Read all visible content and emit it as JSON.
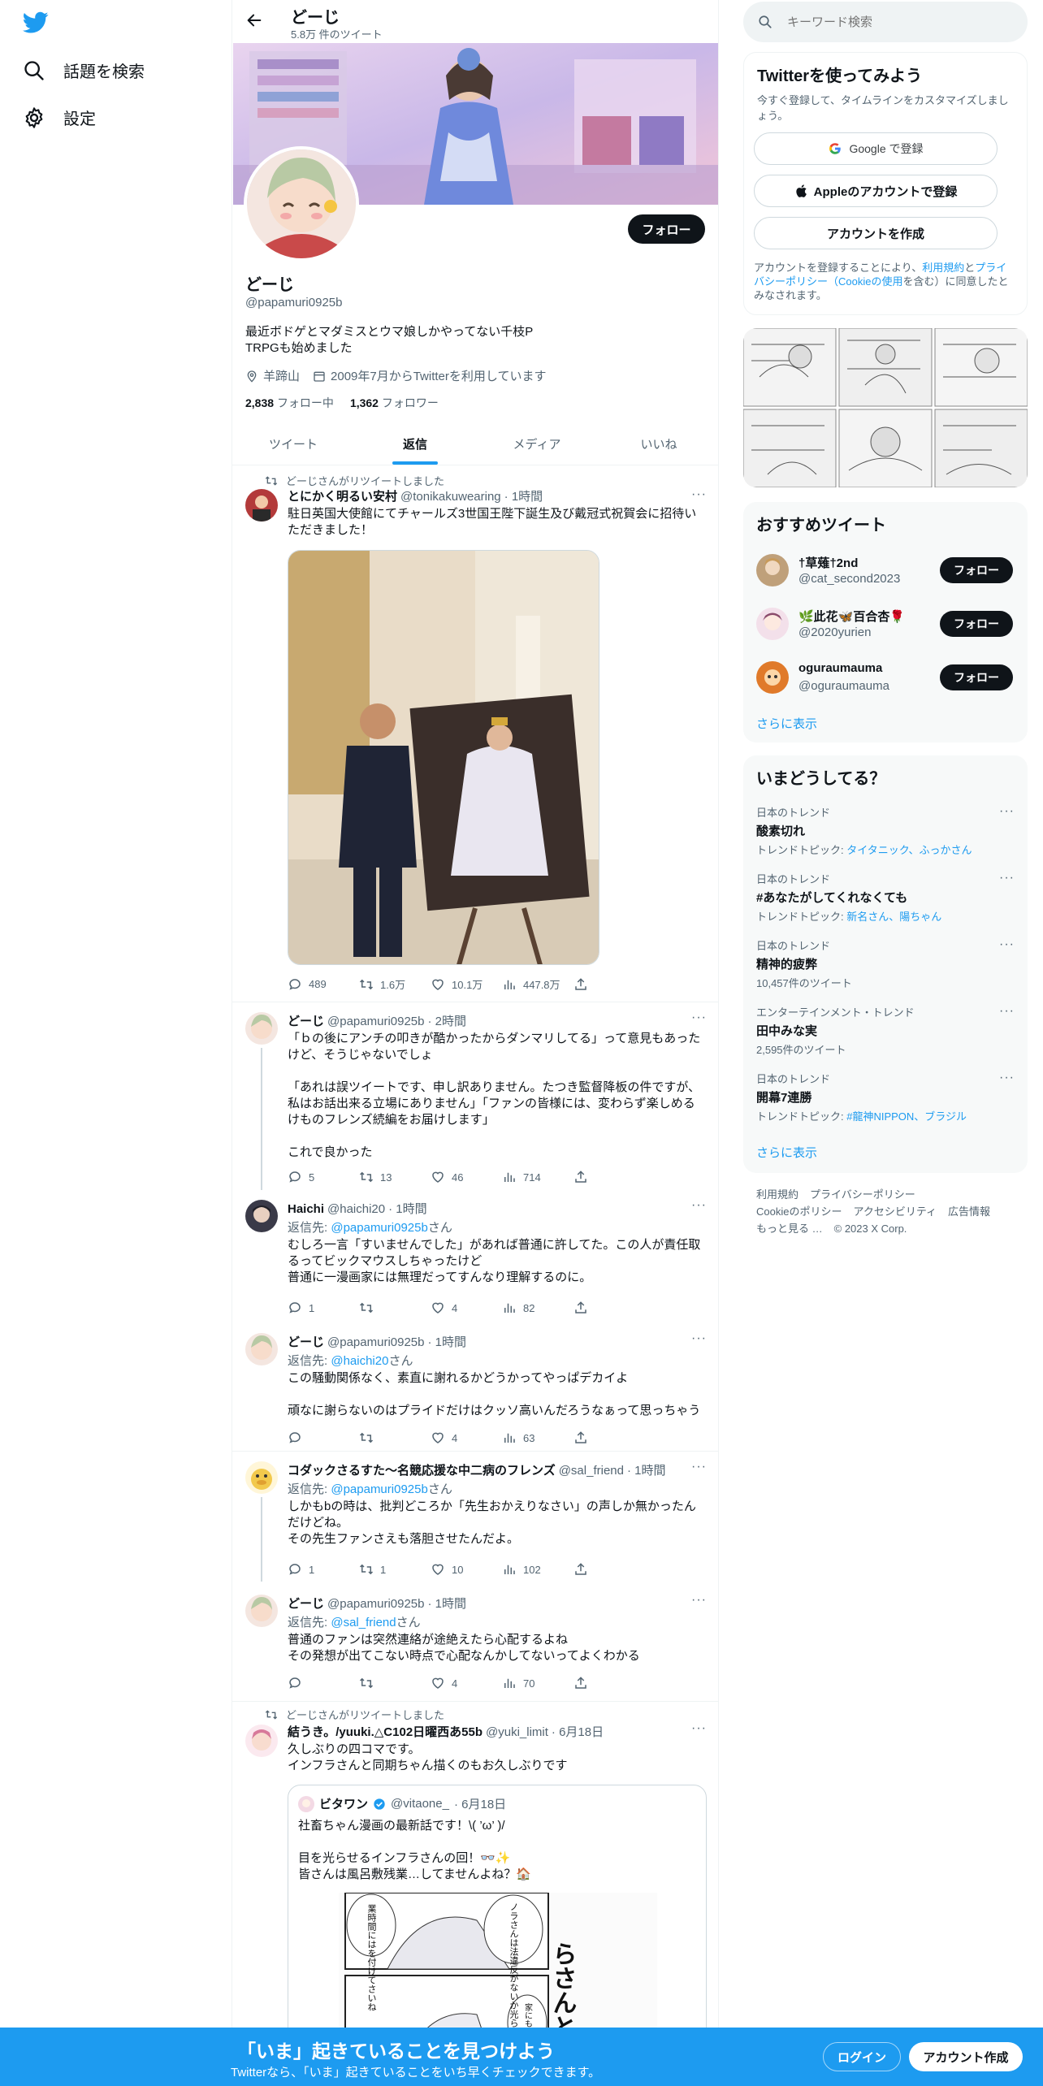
{
  "nav": {
    "explore_label": "話題を検索",
    "settings_label": "設定"
  },
  "profile": {
    "name": "どーじ",
    "tweet_count": "5.8万 件のツイート",
    "handle": "@papamuri0925b",
    "bio_line1": "最近ボドゲとマダミスとウマ娘しかやってない千枝P",
    "bio_line2": "TRPGも始めました",
    "location": "羊蹄山",
    "joined": "2009年7月からTwitterを利用しています",
    "following_count": "2,838",
    "following_label": "フォロー中",
    "followers_count": "1,362",
    "followers_label": "フォロワー",
    "follow_button": "フォロー"
  },
  "tabs": [
    "ツイート",
    "返信",
    "メディア",
    "いいね"
  ],
  "tweets": [
    {
      "retweet_label": "どーじさんがリツイートしました",
      "name": "とにかく明るい安村",
      "handle": "@tonikakuwearing",
      "time": "· 1時間",
      "text": "駐日英国大使館にてチャールズ3世国王陛下誕生及び戴冠式祝賀会に招待いただきました！",
      "replies": "489",
      "retweets": "1.6万",
      "likes": "10.1万",
      "views": "447.8万"
    },
    {
      "name": "どーじ",
      "handle": "@papamuri0925b",
      "time": "· 2時間",
      "text": "「ｂの後にアンチの叩きが酷かったからダンマリしてる」って意見もあったけど、そうじゃないでしょ\n\n「あれは誤ツイートです、申し訳ありません。たつき監督降板の件ですが、私はお話出来る立場にありません」「ファンの皆様には、変わらず楽しめるけものフレンズ続編をお届けします」\n\nこれで良かった",
      "replies": "5",
      "retweets": "13",
      "likes": "46",
      "views": "714"
    },
    {
      "name": "Haichi",
      "handle": "@haichi20",
      "time": "· 1時間",
      "reply_prefix": "返信先: ",
      "reply_to": "@papamuri0925b",
      "reply_suffix": "さん",
      "text": "むしろ一言「すいませんでした」があれば普通に許してた。この人が責任取るってビックマウスしちゃったけど\n普通に一漫画家には無理だってすんなり理解するのに。",
      "replies": "1",
      "retweets": "",
      "likes": "4",
      "views": "82"
    },
    {
      "name": "どーじ",
      "handle": "@papamuri0925b",
      "time": "· 1時間",
      "reply_prefix": "返信先: ",
      "reply_to": "@haichi20",
      "reply_suffix": "さん",
      "text": "この騒動関係なく、素直に謝れるかどうかってやっぱデカイよ\n\n頑なに謝らないのはプライドだけはクッソ高いんだろうなぁって思っちゃう",
      "replies": "",
      "retweets": "",
      "likes": "4",
      "views": "63"
    },
    {
      "name": "コダックさるすた〜名競応援な中二病のフレンズ",
      "handle": "@sal_friend",
      "time": "· 1時間",
      "reply_prefix": "返信先: ",
      "reply_to": "@papamuri0925b",
      "reply_suffix": "さん",
      "text": "しかもbの時は、批判どころか「先生おかえりなさい」の声しか無かったんだけどね。\nその先生ファンさえも落胆させたんだよ。",
      "replies": "1",
      "retweets": "1",
      "likes": "10",
      "views": "102"
    },
    {
      "name": "どーじ",
      "handle": "@papamuri0925b",
      "time": "· 1時間",
      "reply_prefix": "返信先: ",
      "reply_to": "@sal_friend",
      "reply_suffix": "さん",
      "text": "普通のファンは突然連絡が途絶えたら心配するよね\nその発想が出てこない時点で心配なんかしてないってよくわかる",
      "replies": "",
      "retweets": "",
      "likes": "4",
      "views": "70"
    },
    {
      "retweet_label": "どーじさんがリツイートしました",
      "name": "結うき。/yuuki.△C102日曜西あ55b",
      "handle": "@yuki_limit",
      "time": "· 6月18日",
      "text": "久しぶりの四コマです。\nインフラさんと同期ちゃん描くのもお久しぶりです"
    }
  ],
  "quote": {
    "name": "ビタワン",
    "handle": "@vitaone_",
    "time": "· 6月18日",
    "text": "社畜ちゃん漫画の最新話です！\\( ’ω’ )/\n\n目を光らせるインフラさんの回！👓✨\n皆さんは風呂敷残業…してませんよね？🏠"
  },
  "manga_text": {
    "a": "ノラさんは法違反がないか光らせてす",
    "b": "業時間にはを付けてさいね",
    "c": "らさんと風呂敷",
    "d": "家にも残業して"
  },
  "search": {
    "placeholder": "キーワード検索"
  },
  "signup": {
    "title": "Twitterを使ってみよう",
    "subtitle": "今すぐ登録して、タイムラインをカスタマイズしましょう。",
    "google_button": "Google で登録",
    "apple_button": "Appleのアカウントで登録",
    "create_button": "アカウントを作成",
    "legal_pre": "アカウントを登録することにより、",
    "terms_link": "利用規約",
    "and": "と",
    "privacy_link": "プライバシーポリシー",
    "cookie_link": "（Cookieの使用",
    "legal_post": "を含む）に同意したとみなされます。"
  },
  "recommended": {
    "title": "おすすめツイート",
    "users": [
      {
        "name": "†草薙†2nd",
        "handle": "@cat_second2023",
        "button": "フォロー"
      },
      {
        "name": "🌿此花🦋百合杏🌹",
        "handle": "@2020yurien",
        "button": "フォロー"
      },
      {
        "name": "oguraumauma",
        "handle": "@oguraumauma",
        "button": "フォロー"
      }
    ],
    "show_more": "さらに表示"
  },
  "trends": {
    "title": "いまどうしてる？",
    "items": [
      {
        "category": "日本のトレンド",
        "name": "酸素切れ",
        "sub_prefix": "トレンドトピック: ",
        "sub_links": "タイタニック、ふっかさん"
      },
      {
        "category": "日本のトレンド",
        "name": "#あなたがしてくれなくても",
        "sub_prefix": "トレンドトピック: ",
        "sub_links": "新名さん、陽ちゃん"
      },
      {
        "category": "日本のトレンド",
        "name": "精神的疲弊",
        "sub_prefix": "10,457件のツイート",
        "sub_links": ""
      },
      {
        "category": "エンターテインメント・トレンド",
        "name": "田中みな実",
        "sub_prefix": "2,595件のツイート",
        "sub_links": ""
      },
      {
        "category": "日本のトレンド",
        "name": "開幕7連勝",
        "sub_prefix": "トレンドトピック: ",
        "sub_links": "#龍神NIPPON、ブラジル"
      }
    ],
    "show_more": "さらに表示"
  },
  "footer": {
    "terms": "利用規約",
    "privacy": "プライバシーポリシー",
    "cookie": "Cookieのポリシー",
    "accessibility": "アクセシビリティ",
    "ads": "広告情報",
    "more": "もっと見る …",
    "copyright": "© 2023 X Corp."
  },
  "bottom_bar": {
    "title": "「いま」起きていることを見つけよう",
    "subtitle": "Twitterなら、「いま」起きていることをいち早くチェックできます。",
    "login": "ログイン",
    "signup": "アカウント作成"
  },
  "colors": {
    "accent": "#1d9bf0",
    "text": "#0f1419",
    "muted": "#536471",
    "bottom_bar": "#1d9bf0"
  }
}
